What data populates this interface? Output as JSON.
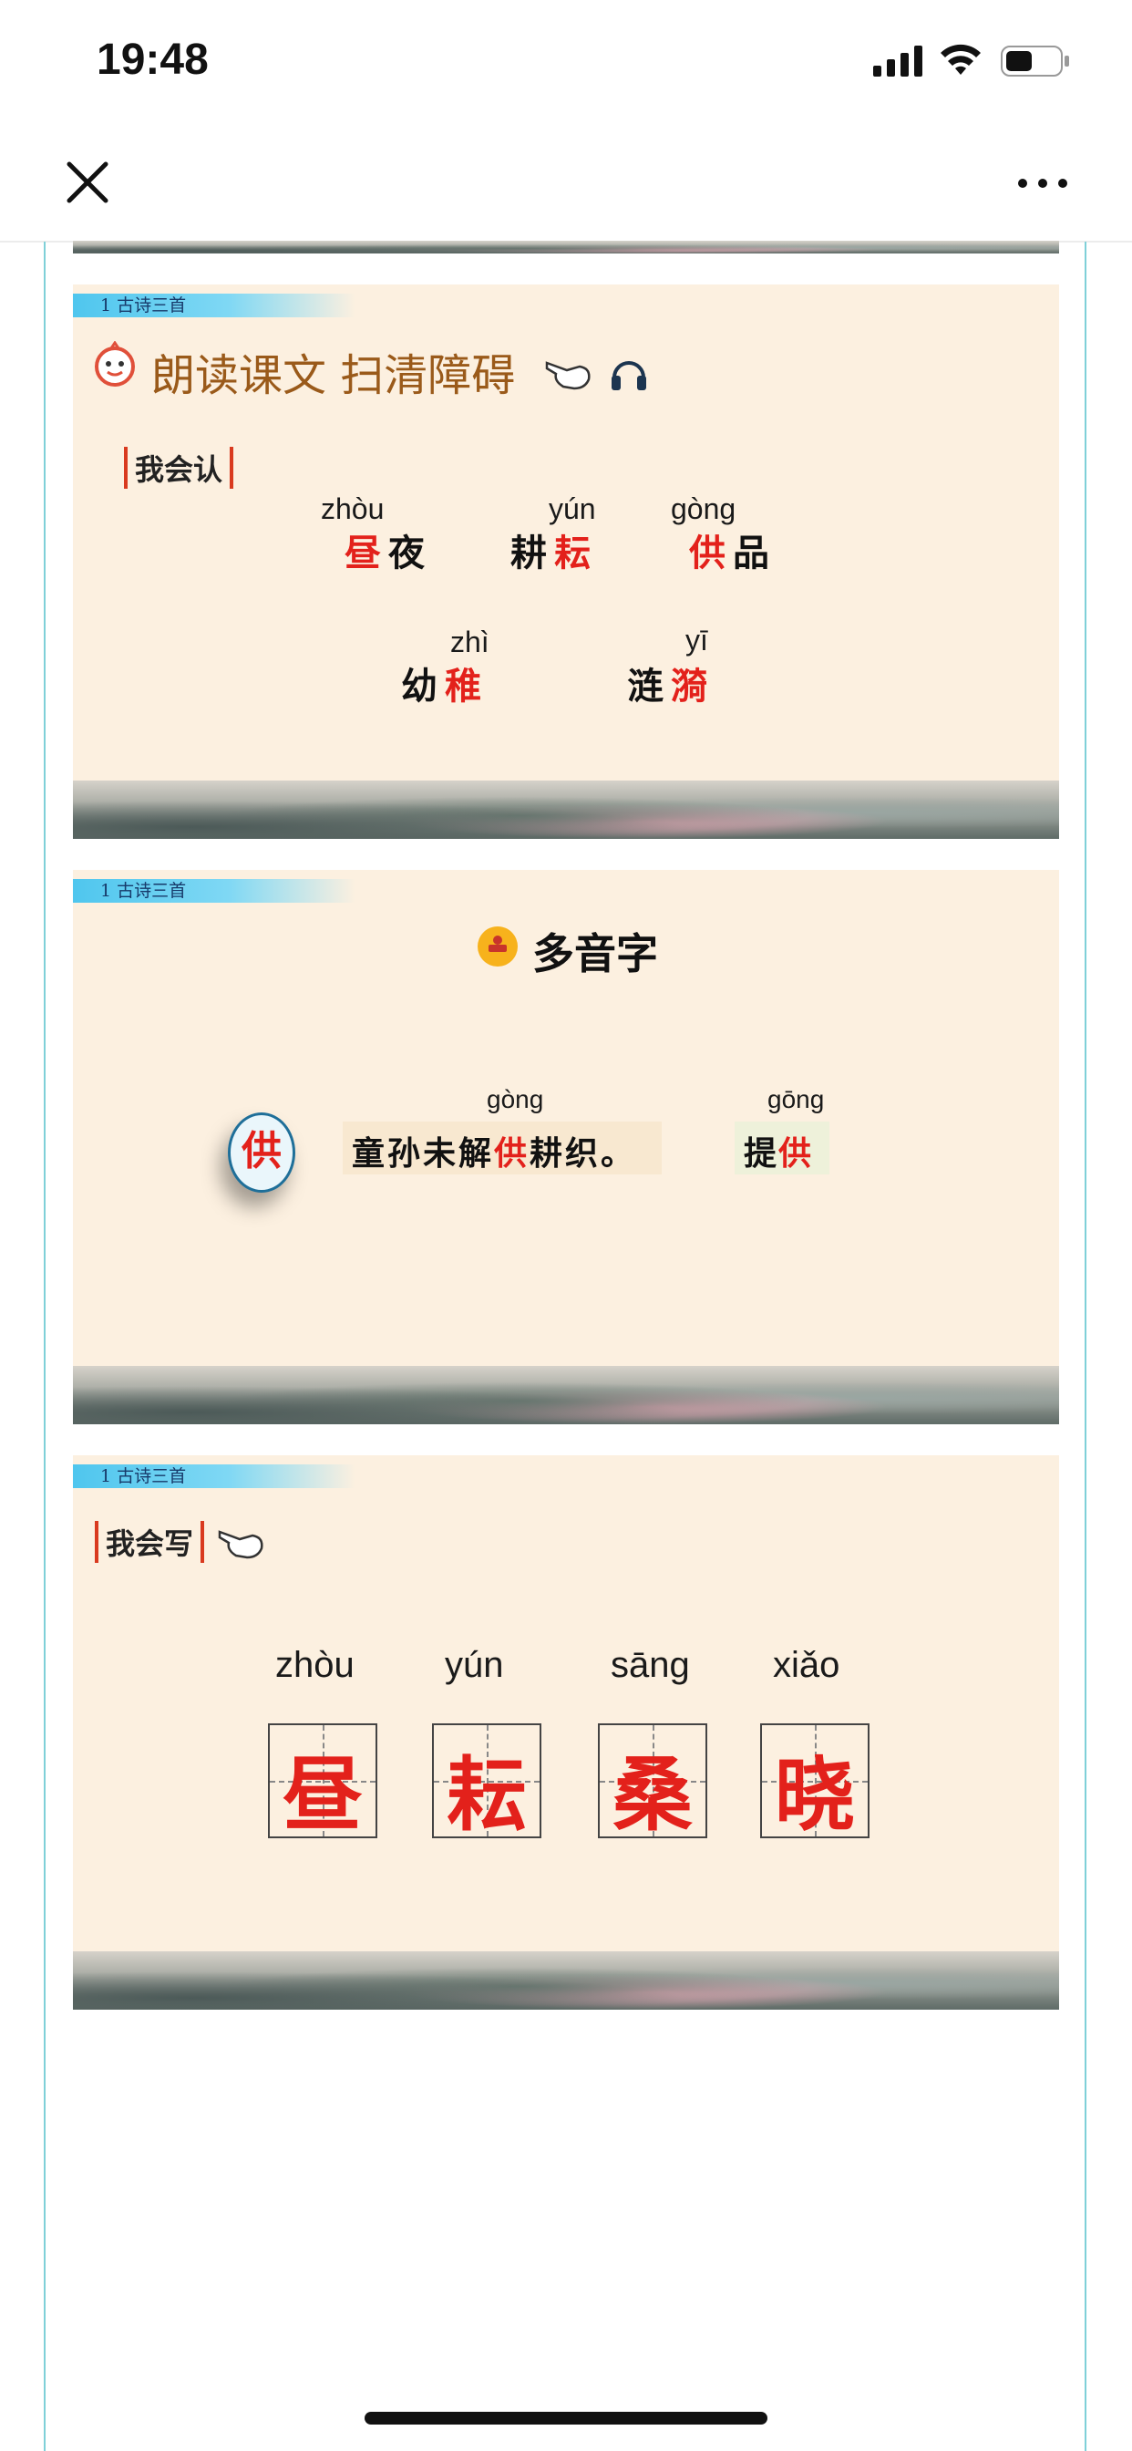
{
  "status_bar": {
    "time": "19:48"
  },
  "nav": {
    "close_icon": "close-icon",
    "more_icon": "more-icon"
  },
  "slides": [
    {
      "ribbon": "1 古诗三首",
      "heading": "朗读课文 扫清障碍",
      "tag": "我会认",
      "words": [
        {
          "pinyin": "zhòu",
          "plain_before": "",
          "red": "昼",
          "plain_after": "夜"
        },
        {
          "pinyin": "yún",
          "plain_before": "耕",
          "red": "耘",
          "plain_after": ""
        },
        {
          "pinyin": "gòng",
          "plain_before": "",
          "red": "供",
          "plain_after": "品"
        },
        {
          "pinyin": "zhì",
          "plain_before": "幼",
          "red": "稚",
          "plain_after": ""
        },
        {
          "pinyin": "yī",
          "plain_before": "涟",
          "red": "漪",
          "plain_after": ""
        }
      ]
    },
    {
      "ribbon": "1 古诗三首",
      "heading": "多音字",
      "character": "供",
      "sentence": {
        "pinyin": "gòng",
        "before": "童孙未解",
        "red": "供",
        "after": "耕织。"
      },
      "word2": {
        "pinyin": "gōng",
        "before": "提",
        "red": "供"
      }
    },
    {
      "ribbon": "1 古诗三首",
      "tag": "我会写",
      "characters": [
        {
          "pinyin": "zhòu",
          "char": "昼"
        },
        {
          "pinyin": "yún",
          "char": "耘"
        },
        {
          "pinyin": "sāng",
          "char": "桑"
        },
        {
          "pinyin": "xiǎo",
          "char": "晓"
        }
      ]
    }
  ],
  "colors": {
    "accent_red": "#e3211b",
    "slide_bg": "#fcf0e0",
    "ribbon": "#4fc6ee",
    "frame_border": "#7fd0d8"
  }
}
